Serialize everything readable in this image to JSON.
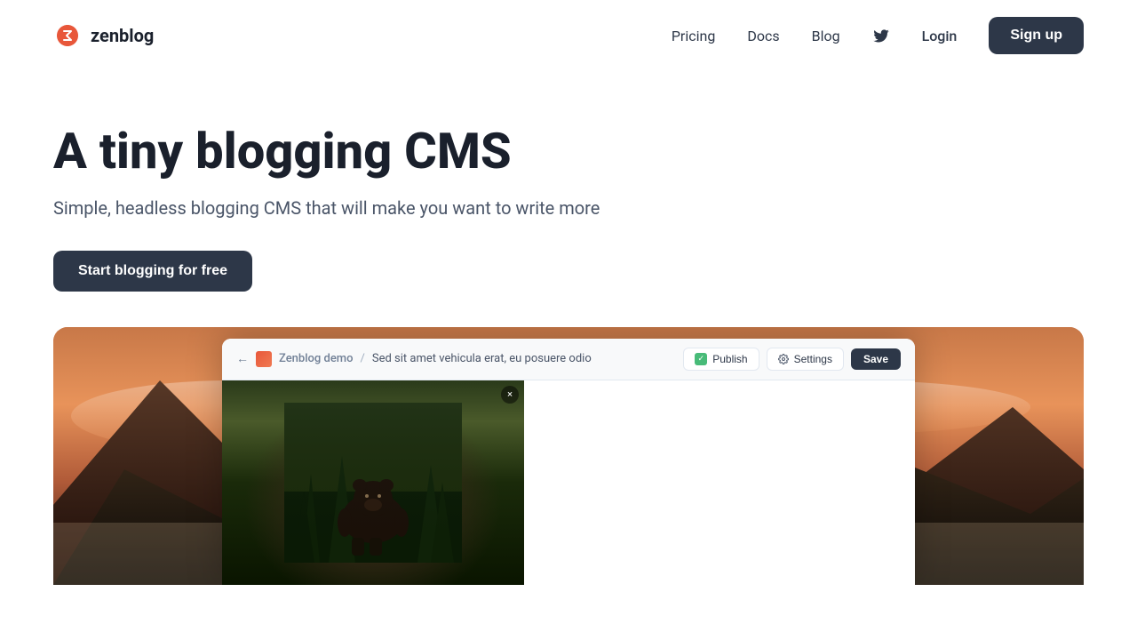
{
  "logo": {
    "text": "zenblog"
  },
  "nav": {
    "links": [
      {
        "id": "pricing",
        "label": "Pricing"
      },
      {
        "id": "docs",
        "label": "Docs"
      },
      {
        "id": "blog",
        "label": "Blog"
      }
    ],
    "login_label": "Login",
    "signup_label": "Sign up"
  },
  "hero": {
    "heading": "A tiny blogging CMS",
    "subheading": "Simple, headless blogging CMS that will make you want to write more",
    "cta_label": "Start blogging for free"
  },
  "cms_demo": {
    "back_label": "←",
    "site_name": "Zenblog demo",
    "separator": "/",
    "post_title": "Sed sit amet vehicula erat, eu posuere odio",
    "publish_label": "Publish",
    "settings_label": "Settings",
    "save_label": "Save",
    "close_label": "×"
  }
}
